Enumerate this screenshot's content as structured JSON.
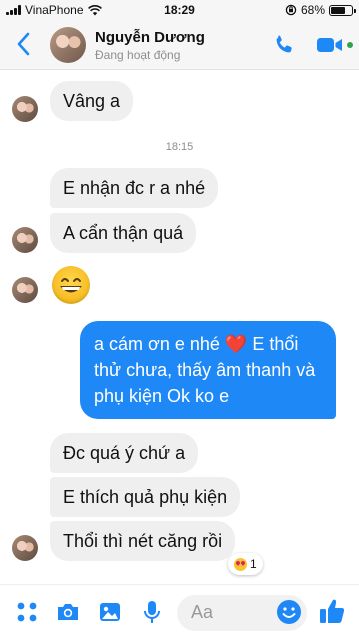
{
  "status_bar": {
    "carrier": "VinaPhone",
    "time": "18:29",
    "battery": "68%",
    "battery_level": 0.68
  },
  "header": {
    "contact_name": "Nguyễn Dương",
    "contact_status": "Đang hoạt động"
  },
  "messages": [
    {
      "direction": "incoming",
      "text": "Vâng a"
    },
    {
      "timestamp": "18:15"
    },
    {
      "direction": "incoming",
      "text": "E nhận đc r a nhé"
    },
    {
      "direction": "incoming",
      "text": "A cẩn thận quá"
    },
    {
      "direction": "incoming",
      "emoji": "grinning-face"
    },
    {
      "direction": "outgoing",
      "text_before_emoji": "a cám ơn e nhé",
      "emoji": "❤️",
      "text_after_emoji": "E thổi thử chưa, thấy âm thanh và phụ kiện Ok ko e"
    },
    {
      "direction": "incoming",
      "text": "Đc quá ý chứ a"
    },
    {
      "direction": "incoming",
      "text": "E thích quả phụ kiện"
    },
    {
      "direction": "incoming",
      "text": "Thổi thì nét căng rồi",
      "reaction": {
        "icon": "heart-eyes-emoji",
        "count": "1"
      }
    }
  ],
  "composer": {
    "placeholder": "Aa"
  },
  "colors": {
    "accent": "#1e88f7",
    "incoming_bubble": "#efefef",
    "online": "#31a24c"
  },
  "icons": [
    "back-chevron-icon",
    "phone-icon",
    "video-camera-icon",
    "apps-icon",
    "camera-icon",
    "gallery-icon",
    "microphone-icon",
    "emoji-icon",
    "thumbs-up-icon"
  ]
}
